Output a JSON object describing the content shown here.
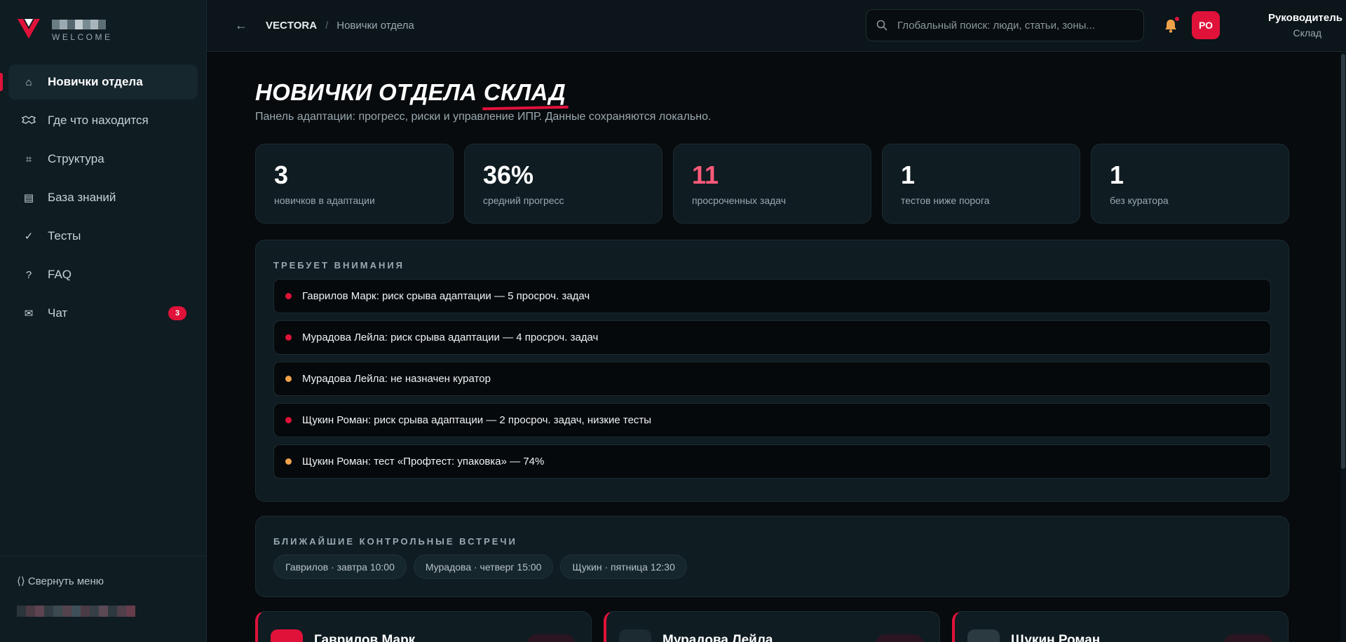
{
  "brand": {
    "welcome": "WELCOME",
    "accent": "#e0123a"
  },
  "sidebar": {
    "items": [
      {
        "label": "Новички отдела",
        "icon": "home-icon",
        "active": true
      },
      {
        "label": "Где что находится",
        "icon": "map-icon"
      },
      {
        "label": "Структура",
        "icon": "structure-icon"
      },
      {
        "label": "База знаний",
        "icon": "book-icon"
      },
      {
        "label": "Тесты",
        "icon": "check-icon"
      },
      {
        "label": "FAQ",
        "icon": "question-icon"
      },
      {
        "label": "Чат",
        "icon": "mail-icon",
        "badge": "3"
      }
    ],
    "collapse_label": "⟨⟩ Свернуть меню"
  },
  "topbar": {
    "breadcrumb_root": "VECTORA",
    "breadcrumb_sep": "/",
    "breadcrumb_current": "Новички отдела",
    "search_placeholder": "Глобальный поиск: люди, статьи, зоны...",
    "avatar_initials": "РО",
    "user_role": "Руководитель",
    "user_dept": "Склад"
  },
  "page": {
    "title_main": "НОВИЧКИ ОТДЕЛА ",
    "title_accent": "СКЛАД",
    "subtitle": "Панель адаптации: прогресс, риски и управление ИПР. Данные сохраняются локально."
  },
  "stats": [
    {
      "value": "3",
      "label": "новичков в адаптации"
    },
    {
      "value": "36%",
      "label": "средний прогресс"
    },
    {
      "value": "11",
      "label": "просроченных задач",
      "highlight": true
    },
    {
      "value": "1",
      "label": "тестов ниже порога"
    },
    {
      "value": "1",
      "label": "без куратора"
    }
  ],
  "attention": {
    "heading": "ТРЕБУЕТ ВНИМАНИЯ",
    "items": [
      {
        "text": "Гаврилов Марк: риск срыва адаптации — 5 просроч. задач",
        "level": "critical",
        "color": "#e0123a"
      },
      {
        "text": "Мурадова Лейла: риск срыва адаптации — 4 просроч. задач",
        "level": "critical",
        "color": "#e0123a"
      },
      {
        "text": "Мурадова Лейла: не назначен куратор",
        "level": "warning",
        "color": "#f0a24a"
      },
      {
        "text": "Щукин Роман: риск срыва адаптации — 2 просроч. задач, низкие тесты",
        "level": "critical",
        "color": "#e0123a"
      },
      {
        "text": "Щукин Роман: тест «Профтест: упаковка» — 74%",
        "level": "warning",
        "color": "#f0a24a"
      }
    ]
  },
  "meetings": {
    "heading": "БЛИЖАЙШИЕ КОНТРОЛЬНЫЕ ВСТРЕЧИ",
    "items": [
      "Гаврилов · завтра 10:00",
      "Мурадова · четверг 15:00",
      "Щукин · пятница 12:30"
    ]
  },
  "newbies": [
    {
      "name": "Гаврилов Марк",
      "avatar_color": "#e0123a"
    },
    {
      "name": "Мурадова Лейла",
      "avatar_color": "#1c2b32"
    },
    {
      "name": "Щукин Роман",
      "avatar_color": "#2a3a40"
    }
  ]
}
